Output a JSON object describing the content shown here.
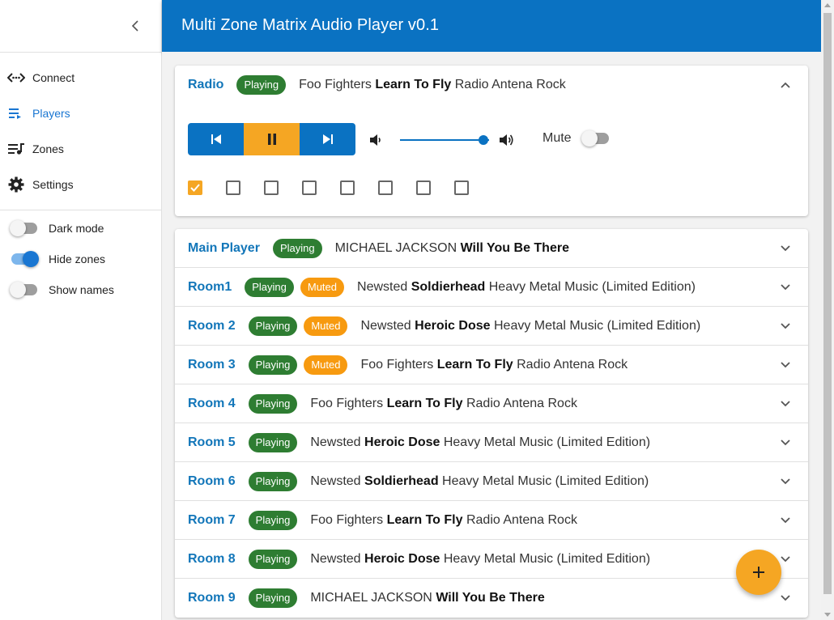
{
  "app": {
    "title": "Multi Zone Matrix Audio Player v0.1"
  },
  "sidebar": {
    "collapse_icon": "chevron-left-icon",
    "nav": [
      {
        "label": "Connect",
        "icon": "connect-icon",
        "active": false
      },
      {
        "label": "Players",
        "icon": "playlist-play-icon",
        "active": true
      },
      {
        "label": "Zones",
        "icon": "queue-music-icon",
        "active": false
      },
      {
        "label": "Settings",
        "icon": "gear-icon",
        "active": false
      }
    ],
    "toggles": [
      {
        "label": "Dark mode",
        "on": false
      },
      {
        "label": "Hide zones",
        "on": true
      },
      {
        "label": "Show names",
        "on": false
      }
    ]
  },
  "colors": {
    "primary": "#0a72c2",
    "accent": "#f5a623",
    "playing": "#2e7d32",
    "muted": "#f79a10",
    "link": "#1276b9"
  },
  "expanded_player": {
    "name": "Radio",
    "status": "Playing",
    "artist": "Foo Fighters",
    "song": "Learn To Fly",
    "album": "Radio Antena Rock",
    "volume": 0.94,
    "mute_label": "Mute",
    "muted": false,
    "zones_checked": [
      true,
      false,
      false,
      false,
      false,
      false,
      false,
      false
    ]
  },
  "players": [
    {
      "name": "Main Player",
      "status": "Playing",
      "muted_label": "",
      "artist": "MICHAEL JACKSON",
      "song": "Will You Be There",
      "album": ""
    },
    {
      "name": "Room1",
      "status": "Playing",
      "muted_label": "Muted",
      "artist": "Newsted",
      "song": "Soldierhead",
      "album": "Heavy Metal Music (Limited Edition)"
    },
    {
      "name": "Room 2",
      "status": "Playing",
      "muted_label": "Muted",
      "artist": "Newsted",
      "song": "Heroic Dose",
      "album": "Heavy Metal Music (Limited Edition)"
    },
    {
      "name": "Room 3",
      "status": "Playing",
      "muted_label": "Muted",
      "artist": "Foo Fighters",
      "song": "Learn To Fly",
      "album": "Radio Antena Rock"
    },
    {
      "name": "Room 4",
      "status": "Playing",
      "muted_label": "",
      "artist": "Foo Fighters",
      "song": "Learn To Fly",
      "album": "Radio Antena Rock"
    },
    {
      "name": "Room 5",
      "status": "Playing",
      "muted_label": "",
      "artist": "Newsted",
      "song": "Heroic Dose",
      "album": "Heavy Metal Music (Limited Edition)"
    },
    {
      "name": "Room 6",
      "status": "Playing",
      "muted_label": "",
      "artist": "Newsted",
      "song": "Soldierhead",
      "album": "Heavy Metal Music (Limited Edition)"
    },
    {
      "name": "Room 7",
      "status": "Playing",
      "muted_label": "",
      "artist": "Foo Fighters",
      "song": "Learn To Fly",
      "album": "Radio Antena Rock"
    },
    {
      "name": "Room 8",
      "status": "Playing",
      "muted_label": "",
      "artist": "Newsted",
      "song": "Heroic Dose",
      "album": "Heavy Metal Music (Limited Edition)"
    },
    {
      "name": "Room 9",
      "status": "Playing",
      "muted_label": "",
      "artist": "MICHAEL JACKSON",
      "song": "Will You Be There",
      "album": ""
    }
  ],
  "fab": {
    "icon": "plus-icon"
  }
}
